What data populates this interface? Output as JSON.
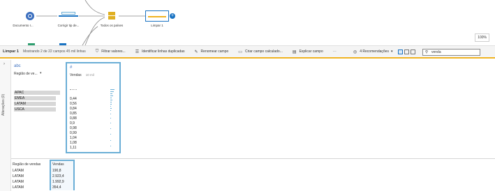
{
  "flow": {
    "nodes": [
      {
        "label": "Documento I...",
        "icon": "input-icon"
      },
      {
        "label": "Corrigir tip de...",
        "icon": "clean-step-icon"
      },
      {
        "label": "Todos os países",
        "icon": "union-icon"
      },
      {
        "label": "Limpar 1",
        "icon": "clean-step-icon"
      }
    ],
    "zoom": "100%"
  },
  "toolbar": {
    "step_title": "Limpar 1",
    "step_info": "Mostrando 2 de 22 campos  45 mil linhas",
    "buttons": [
      {
        "label": "Filtrar valores...",
        "icon": "filter-icon"
      },
      {
        "label": "Identificar linhas duplicadas",
        "icon": "duplicate-rows-icon"
      },
      {
        "label": "Renomear campo",
        "icon": "rename-icon"
      },
      {
        "label": "Criar campo calculado...",
        "icon": "calculated-field-icon"
      },
      {
        "label": "Explicar campo",
        "icon": "explain-icon"
      }
    ],
    "more": "···",
    "recommendations": "4 Recomendações",
    "search_value": "venda"
  },
  "side_panel": {
    "label": "Alterações (0)"
  },
  "profile": {
    "cards": [
      {
        "type_icon": "abc",
        "field": "Região de ve...",
        "bars": [
          "APAC",
          "EMEA",
          "LATAM",
          "USCA"
        ]
      },
      {
        "type_icon": "#",
        "field": "Vendas",
        "subtitle": "10 mil",
        "values": [
          "0,44",
          "0,56",
          "0,84",
          "0,85",
          "0,88",
          "0,9",
          "0,98",
          "0,99",
          "1,04",
          "1,08",
          "1,11"
        ]
      }
    ]
  },
  "grid": {
    "headers": [
      "Região de vendas",
      "Vendas"
    ],
    "rows": [
      [
        "LATAM",
        "190,8"
      ],
      [
        "LATAM",
        "2.923,4"
      ],
      [
        "LATAM",
        "1.992,9"
      ],
      [
        "LATAM",
        "354,4"
      ]
    ]
  },
  "colors": {
    "accent": "#f0b322",
    "selection": "#6aaed6",
    "node_blue": "#3a6ebe"
  }
}
